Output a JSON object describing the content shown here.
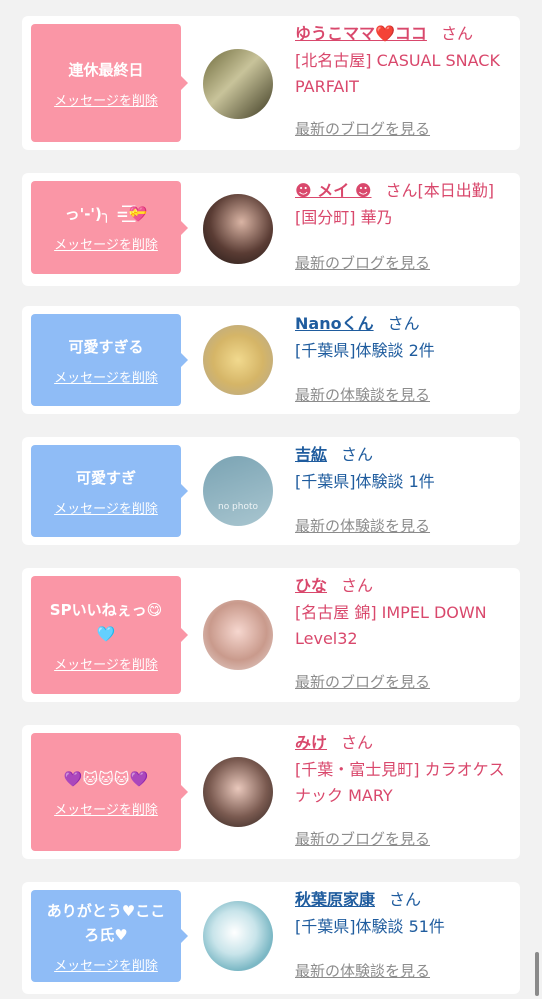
{
  "delete_label": "メッセージを削除",
  "honorific": "さん",
  "entries": [
    {
      "message": "連休最終日",
      "name": "ゆうこママ❤️ココ",
      "detail": "[北名古屋] CASUAL SNACK PARFAIT",
      "link": "最新のブログを見る"
    },
    {
      "message": "っ'-')╮ =͟͟͞͞💝",
      "name": "☻ メイ ☻",
      "badge": "[本日出勤]",
      "detail": "[国分町] 華乃",
      "link": "最新のブログを見る"
    },
    {
      "message": "可愛すぎる",
      "name": "Nanoくん",
      "detail": "[千葉県]体験談 2件",
      "link": "最新の体験談を見る"
    },
    {
      "message": "可愛すぎ",
      "name": "吉紘",
      "detail": "[千葉県]体験談 1件",
      "link": "最新の体験談を見る",
      "avatar_text": "no photo"
    },
    {
      "message": "SPいいねぇっ😋🩵",
      "name": "ひな",
      "detail": "[名古屋 錦] IMPEL DOWN Level32",
      "link": "最新のブログを見る"
    },
    {
      "message": "💜🐱🐱🐱💜",
      "name": "みけ",
      "detail": "[千葉・富士見町] カラオケスナック MARY",
      "link": "最新のブログを見る"
    },
    {
      "message": "ありがとう♥こころ氏♥",
      "name": "秋葉原家康",
      "detail": "[千葉県]体験談 51件",
      "link": "最新の体験談を見る"
    }
  ],
  "colors": {
    "pink": "#fa96a6",
    "blue": "#8fbcf6",
    "name_pink": "#d9486c",
    "name_blue": "#1f5c9e"
  }
}
